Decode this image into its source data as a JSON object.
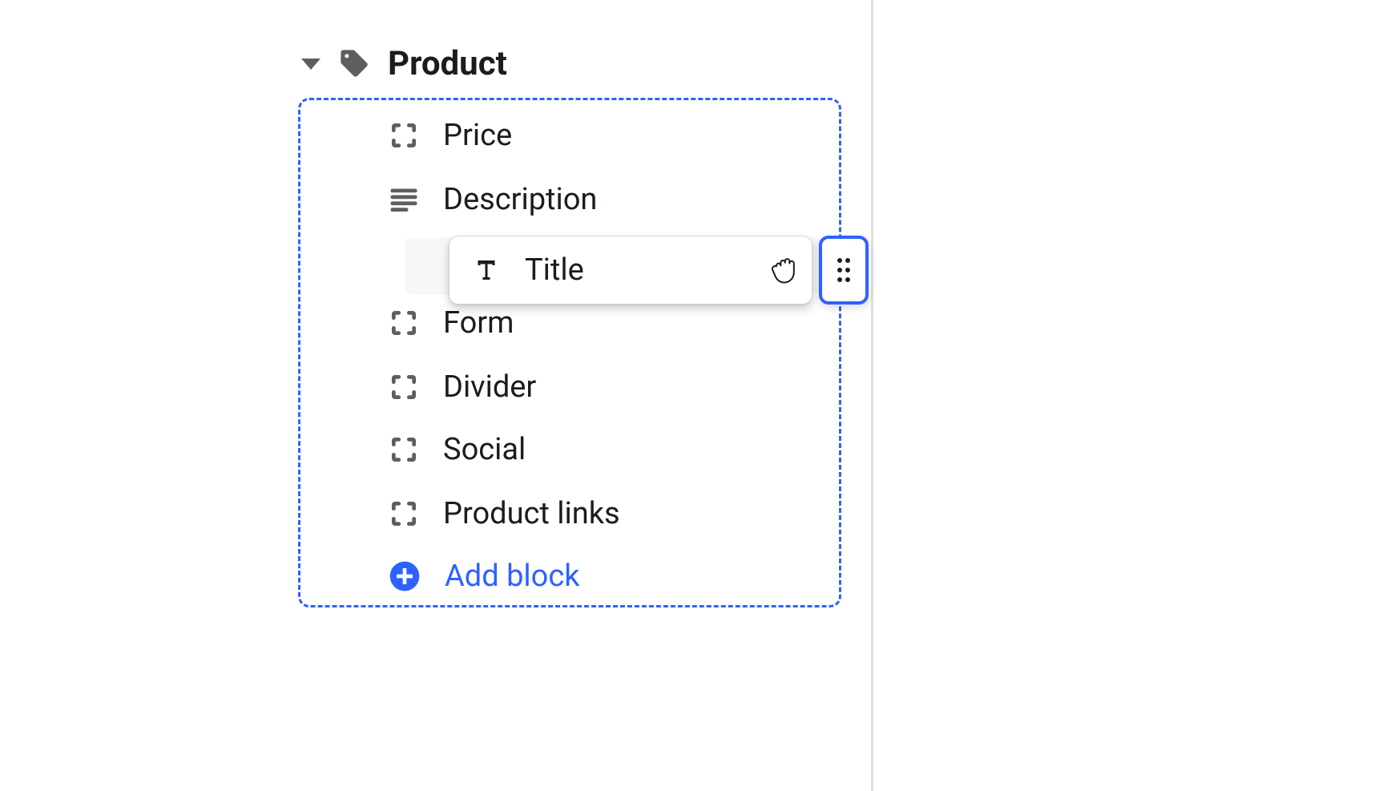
{
  "section": {
    "title": "Product"
  },
  "blocks": {
    "price": {
      "label": "Price"
    },
    "description": {
      "label": "Description"
    },
    "form": {
      "label": "Form"
    },
    "divider": {
      "label": "Divider"
    },
    "social": {
      "label": "Social"
    },
    "product_links": {
      "label": "Product links"
    }
  },
  "dragging_block": {
    "label": "Title"
  },
  "actions": {
    "add_block": "Add block"
  },
  "colors": {
    "accent": "#2d62ff",
    "text": "#1a1c1d",
    "muted": "#5c5f62",
    "placeholder_bg": "#f6f7f9"
  }
}
